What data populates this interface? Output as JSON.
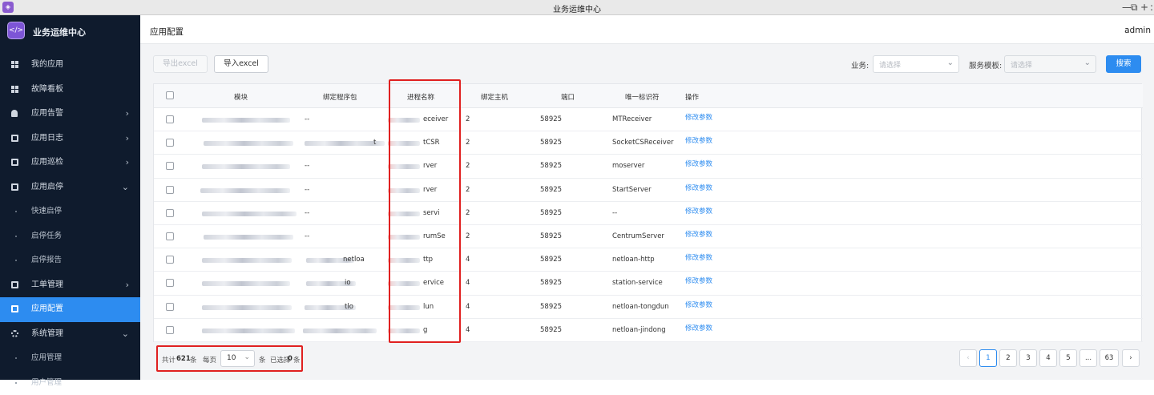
{
  "window": {
    "title": "业务运维中心",
    "controls": [
      "—",
      "⧉",
      "+",
      ":"
    ]
  },
  "brand": {
    "name": "业务运维中心",
    "logo": "</>"
  },
  "sidebar": {
    "items": [
      {
        "label": "我的应用",
        "icon": "grid-icon",
        "chevron": ""
      },
      {
        "label": "故障看板",
        "icon": "grid-icon",
        "chevron": ""
      },
      {
        "label": "应用告警",
        "icon": "bell-icon",
        "chevron": "›"
      },
      {
        "label": "应用日志",
        "icon": "doc-icon",
        "chevron": "›"
      },
      {
        "label": "应用巡检",
        "icon": "doc-icon",
        "chevron": "›"
      },
      {
        "label": "应用启停",
        "icon": "doc-icon",
        "chevron": "⌄"
      },
      {
        "label": "快速启停",
        "icon": "",
        "chevron": ""
      },
      {
        "label": "启停任务",
        "icon": "",
        "chevron": ""
      },
      {
        "label": "启停报告",
        "icon": "",
        "chevron": ""
      },
      {
        "label": "工单管理",
        "icon": "doc-icon",
        "chevron": "›"
      },
      {
        "label": "应用配置",
        "icon": "doc-icon",
        "chevron": ""
      },
      {
        "label": "系统管理",
        "icon": "gear-icon",
        "chevron": "⌄"
      },
      {
        "label": "应用管理",
        "icon": "",
        "chevron": ""
      },
      {
        "label": "用户管理",
        "icon": "",
        "chevron": ""
      }
    ]
  },
  "header": {
    "page_title": "应用配置",
    "user": "admin"
  },
  "toolbar": {
    "export_label": "导出excel",
    "import_label": "导入excel",
    "business_label": "业务:",
    "business_placeholder": "请选择",
    "template_label": "服务模板:",
    "template_placeholder": "请选择",
    "search_label": "搜索"
  },
  "table": {
    "columns": [
      "模块",
      "绑定程序包",
      "进程名称",
      "绑定主机",
      "端口",
      "唯一标识符",
      "操作"
    ],
    "rows": [
      {
        "package": "--",
        "process": "eceiver",
        "host": "2",
        "port": "58925",
        "uid": "MTReceiver",
        "action": "修改参数"
      },
      {
        "package": "t",
        "process": "tCSR",
        "host": "2",
        "port": "58925",
        "uid": "SocketCSReceiver",
        "action": "修改参数"
      },
      {
        "package": "--",
        "process": "rver",
        "host": "2",
        "port": "58925",
        "uid": "moserver",
        "action": "修改参数"
      },
      {
        "package": "--",
        "process": "rver",
        "host": "2",
        "port": "58925",
        "uid": "StartServer",
        "action": "修改参数"
      },
      {
        "package": "--",
        "process": "servi",
        "host": "2",
        "port": "58925",
        "uid": "--",
        "action": "修改参数"
      },
      {
        "package": "--",
        "process": "rumSe",
        "host": "2",
        "port": "58925",
        "uid": "CentrumServer",
        "action": "修改参数"
      },
      {
        "package": "netloa",
        "process": "ttp",
        "host": "4",
        "port": "58925",
        "uid": "netloan-http",
        "action": "修改参数"
      },
      {
        "package": "io",
        "process": "ervice",
        "host": "4",
        "port": "58925",
        "uid": "station-service",
        "action": "修改参数"
      },
      {
        "package": "tlo",
        "process": "lun",
        "host": "4",
        "port": "58925",
        "uid": "netloan-tongdun",
        "action": "修改参数"
      },
      {
        "package": "",
        "process": "g",
        "host": "4",
        "port": "58925",
        "uid": "netloan-jindong",
        "action": "修改参数"
      }
    ]
  },
  "pagination": {
    "total_prefix": "共计",
    "total": "621",
    "total_suffix": "条",
    "per_page_label": "每页",
    "per_page": "10",
    "per_page_suffix": "条",
    "selected_prefix": "已选择",
    "selected": "0",
    "selected_suffix": "条",
    "prev": "‹",
    "pages": [
      "1",
      "2",
      "3",
      "4",
      "5",
      "...",
      "63"
    ],
    "next": "›",
    "current": "1"
  },
  "colors": {
    "sidebar_bg": "#0f1b2d",
    "accent": "#2d8cf0",
    "highlight": "#e02020"
  }
}
